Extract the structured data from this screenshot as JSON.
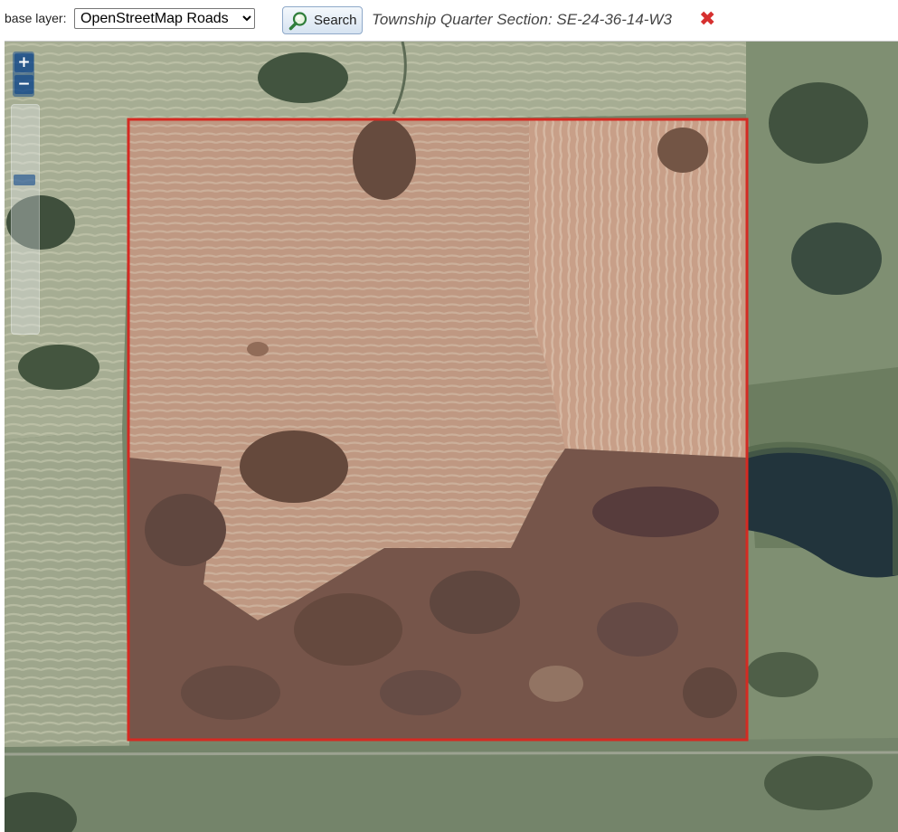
{
  "toolbar": {
    "base_layer_label": "base layer:",
    "base_layer_options": [
      "OpenStreetMap Roads"
    ],
    "base_layer_selected": "OpenStreetMap Roads",
    "search_label": "Search",
    "search_icon": "magnifier-icon",
    "section_title": "Township Quarter Section: SE-24-36-14-W3",
    "close_icon": "close-icon",
    "close_glyph": "✖"
  },
  "map": {
    "zoom_in_label": "+",
    "zoom_out_label": "−",
    "overlay_color": "#d42a22",
    "overlay_fill": "#b8786c"
  }
}
